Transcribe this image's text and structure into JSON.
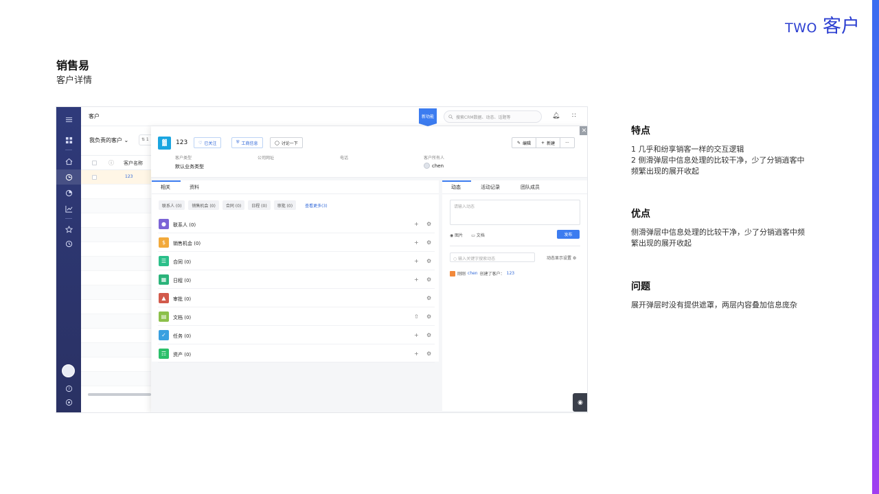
{
  "header": {
    "tag_en": "TWO",
    "tag_cn": "客户"
  },
  "slide": {
    "title": "销售易",
    "subtitle": "客户详情"
  },
  "notes": [
    {
      "heading": "特点",
      "lines": [
        "1 几乎和纷享销客一样的交互逻辑",
        "2 侧滑弹层中信息处理的比较干净，少了分销逍客中",
        "频繁出现的展开收起"
      ]
    },
    {
      "heading": "优点",
      "lines": [
        "侧滑弹层中信息处理的比较干净，少了分销逍客中频",
        "繁出现的展开收起"
      ]
    },
    {
      "heading": "问题",
      "lines": [
        "展开弹层时没有提供遮罩，两层内容叠加信息庞杂"
      ]
    }
  ],
  "app": {
    "breadcrumb": "客户",
    "new_feature_badge": "新功能",
    "search_placeholder": "搜索CRM数据、动态、话题等",
    "list": {
      "filter": "我负责的客户 ⌄",
      "filter2": "⇅ 1",
      "col_name": "客户名称",
      "first_row": "123"
    },
    "detail": {
      "name": "123",
      "pill_follow": "已关注",
      "pill_business": "工商信息",
      "pill_discuss": "讨论一下",
      "btn_edit": "编辑",
      "btn_new": "新建",
      "btn_more": "···",
      "meta": [
        {
          "label": "客户类型",
          "value": "默认业务类型"
        },
        {
          "label": "公司网址",
          "value": ""
        },
        {
          "label": "电话",
          "value": ""
        },
        {
          "label": "客户所有人",
          "value": "chen"
        }
      ],
      "tabs": [
        "相关",
        "资料"
      ],
      "chips": [
        "联系人 (0)",
        "销售机会 (0)",
        "合同 (0)",
        "日程 (0)",
        "审批 (0)"
      ],
      "chips_more": "查看更多(3)",
      "related": [
        {
          "label": "联系人  (0)",
          "color": "#7b64d6",
          "icon": "user-icon"
        },
        {
          "label": "销售机会  (0)",
          "color": "#f2a93b",
          "icon": "money-icon"
        },
        {
          "label": "合同  (0)",
          "color": "#2bbf8a",
          "icon": "document-icon"
        },
        {
          "label": "日程  (0)",
          "color": "#2bb37a",
          "icon": "calendar-icon"
        },
        {
          "label": "审批  (0)",
          "color": "#d25a4b",
          "icon": "stamp-icon"
        },
        {
          "label": "文档  (0)",
          "color": "#8cc04a",
          "icon": "file-icon"
        },
        {
          "label": "任务  (0)",
          "color": "#3aa0e0",
          "icon": "task-icon"
        },
        {
          "label": "资产  (0)",
          "color": "#2bbf6a",
          "icon": "barcode-icon"
        }
      ],
      "right_tabs": [
        "动态",
        "活动记录",
        "团队成员"
      ],
      "post_placeholder": "请输入动态",
      "post_image": "图片",
      "post_doc": "文档",
      "post_button": "发布",
      "activity_search_placeholder": "输入关键字搜索动态",
      "activity_settings": "动态显示设置",
      "activity_prefix": "刚刚",
      "activity_user": "chen",
      "activity_text": "创建了客户：",
      "activity_target": "123"
    }
  }
}
